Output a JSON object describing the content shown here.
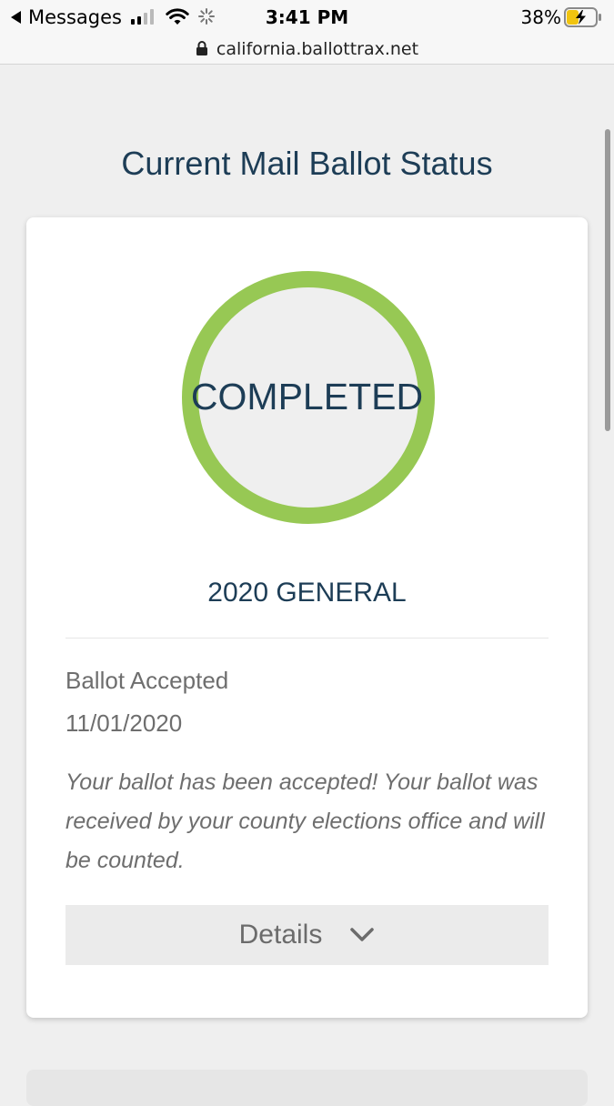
{
  "status_bar": {
    "back_label": "Messages",
    "time": "3:41 PM",
    "battery_percent": "38%",
    "signal_bars_filled": 2,
    "signal_bars_total": 4,
    "battery_level": 0.38,
    "battery_charging": true
  },
  "browser": {
    "url": "california.ballottrax.net"
  },
  "page": {
    "title": "Current Mail Ballot Status"
  },
  "ballot": {
    "status": "COMPLETED",
    "status_ring_color": "#97c854",
    "election": "2020 GENERAL",
    "event_label": "Ballot Accepted",
    "event_date": "11/01/2020",
    "event_description": "Your ballot has been accepted! Your ballot was received by your county elections office and will be counted.",
    "details_label": "Details",
    "details_icon": "chevron-down-icon"
  },
  "colors": {
    "heading": "#1d3d56",
    "body_text": "#6e6e6e",
    "background": "#efefef",
    "card": "#ffffff",
    "accent_green": "#97c854"
  }
}
